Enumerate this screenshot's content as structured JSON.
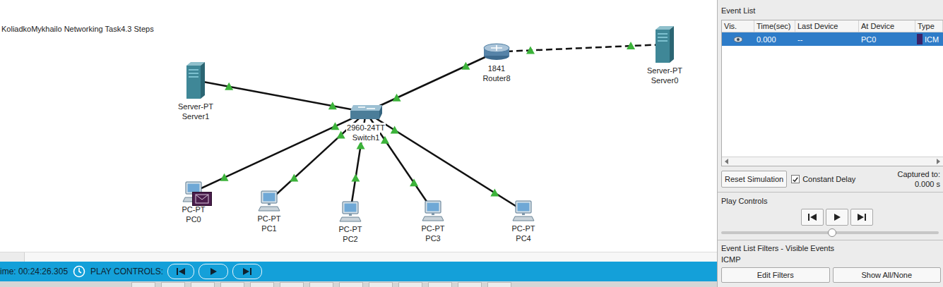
{
  "canvas": {
    "title": "KoliadkoMykhailo Networking Task4.3 Steps"
  },
  "devices": [
    {
      "name": "Server1",
      "model": "Server-PT",
      "kind": "server",
      "pdu": false
    },
    {
      "name": "Router8",
      "model": "1841",
      "kind": "router",
      "pdu": false
    },
    {
      "name": "Server0",
      "model": "Server-PT",
      "kind": "server",
      "pdu": false
    },
    {
      "name": "Switch1",
      "model": "2960-24TT",
      "kind": "switch",
      "pdu": false
    },
    {
      "name": "PC0",
      "model": "PC-PT",
      "kind": "pc",
      "pdu": true
    },
    {
      "name": "PC1",
      "model": "PC-PT",
      "kind": "pc",
      "pdu": false
    },
    {
      "name": "PC2",
      "model": "PC-PT",
      "kind": "pc",
      "pdu": false
    },
    {
      "name": "PC3",
      "model": "PC-PT",
      "kind": "pc",
      "pdu": false
    },
    {
      "name": "PC4",
      "model": "PC-PT",
      "kind": "pc",
      "pdu": false
    }
  ],
  "links": [
    {
      "from": "Server1",
      "to": "Switch1",
      "kind": "straight",
      "up": true
    },
    {
      "from": "Router8",
      "to": "Switch1",
      "kind": "straight",
      "up": true
    },
    {
      "from": "Router8",
      "to": "Server0",
      "kind": "crossover",
      "up": true
    },
    {
      "from": "Switch1",
      "to": "PC0",
      "kind": "straight",
      "up": true
    },
    {
      "from": "Switch1",
      "to": "PC1",
      "kind": "straight",
      "up": true
    },
    {
      "from": "Switch1",
      "to": "PC2",
      "kind": "straight",
      "up": true
    },
    {
      "from": "Switch1",
      "to": "PC3",
      "kind": "straight",
      "up": true
    },
    {
      "from": "Switch1",
      "to": "PC4",
      "kind": "straight",
      "up": true
    }
  ],
  "time_bar": {
    "time": "ime: 00:24:26.305",
    "label": "PLAY CONTROLS:"
  },
  "event_list": {
    "title": "Event List",
    "columns": [
      "Vis.",
      "Time(sec)",
      "Last Device",
      "At Device",
      "Type"
    ],
    "rows": [
      {
        "time": "0.000",
        "last_device": "--",
        "at_device": "PC0",
        "type": "ICM",
        "color": "#3c2266",
        "selected": true
      }
    ],
    "reset_button": "Reset Simulation",
    "constant_delay": {
      "label": "Constant Delay",
      "checked": true
    },
    "captured": {
      "label": "Captured to:",
      "value": "0.000 s"
    }
  },
  "play_controls": {
    "title": "Play Controls",
    "level": 0.51
  },
  "filters": {
    "title": "Event List Filters - Visible Events",
    "visible": "ICMP",
    "buttons": [
      "Edit Filters",
      "Show All/None"
    ]
  }
}
